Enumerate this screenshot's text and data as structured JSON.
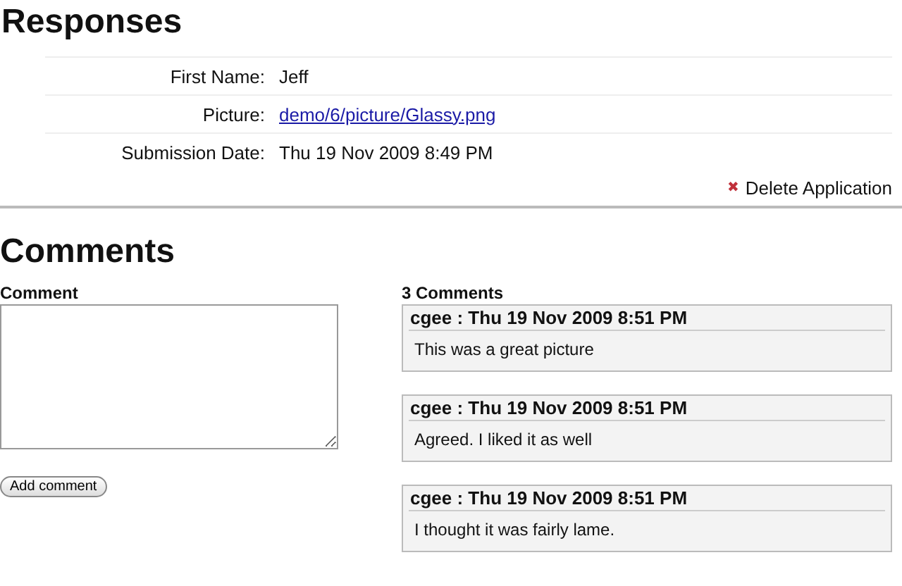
{
  "responses": {
    "title": "Responses",
    "fields": [
      {
        "label": "First Name:",
        "value": "Jeff",
        "kind": "text"
      },
      {
        "label": "Picture:",
        "value": "demo/6/picture/Glassy.png",
        "kind": "link"
      },
      {
        "label": "Submission Date:",
        "value": "Thu 19 Nov 2009 8:49 PM",
        "kind": "text"
      }
    ],
    "delete_action": {
      "icon": "✖",
      "label": "Delete Application"
    }
  },
  "comments": {
    "title": "Comments",
    "form_label": "Comment",
    "submit_button": "Add comment",
    "count_label": "3 Comments",
    "items": [
      {
        "header": "cgee : Thu 19 Nov 2009 8:51 PM",
        "body": "This was a great picture"
      },
      {
        "header": "cgee : Thu 19 Nov 2009 8:51 PM",
        "body": "Agreed. I liked it as well"
      },
      {
        "header": "cgee : Thu 19 Nov 2009 8:51 PM",
        "body": "I thought it was fairly lame."
      }
    ]
  }
}
